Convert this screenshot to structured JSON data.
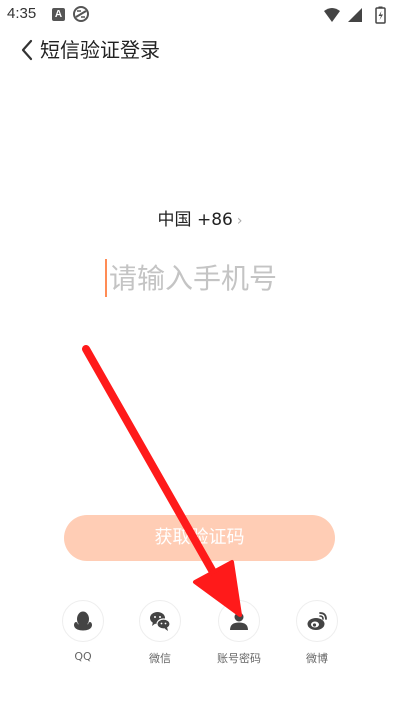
{
  "status_bar": {
    "time": "4:35",
    "left_icons": [
      "a-box-icon",
      "data-saver-icon"
    ],
    "right_icons": [
      "wifi-icon",
      "cell-signal-icon",
      "battery-charging-icon"
    ]
  },
  "header": {
    "back_icon": "chevron-left-icon",
    "title": "短信验证登录"
  },
  "country_selector": {
    "label": "中国 +86",
    "chevron": "›"
  },
  "phone_input": {
    "value": "",
    "placeholder": "请输入手机号"
  },
  "get_code_button": {
    "label": "获取验证码"
  },
  "login_options": [
    {
      "icon": "qq-icon",
      "label": "QQ"
    },
    {
      "icon": "wechat-icon",
      "label": "微信"
    },
    {
      "icon": "user-icon",
      "label": "账号密码"
    },
    {
      "icon": "weibo-icon",
      "label": "微博"
    }
  ],
  "colors": {
    "accent": "#ff8c55",
    "button_disabled": "#ffcdb5",
    "annotation_arrow": "#ff1a1a"
  }
}
